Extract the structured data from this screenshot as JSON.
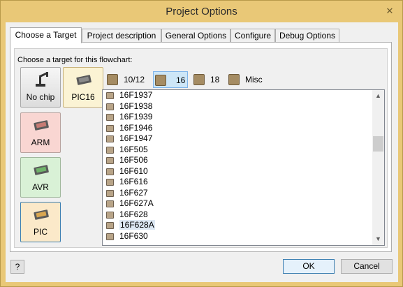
{
  "window": {
    "title": "Project Options",
    "close_glyph": "✕"
  },
  "tabs": [
    {
      "label": "Choose a Target",
      "active": true
    },
    {
      "label": "Project description",
      "active": false
    },
    {
      "label": "General Options",
      "active": false
    },
    {
      "label": "Configure",
      "active": false
    },
    {
      "label": "Debug Options",
      "active": false
    }
  ],
  "target_panel": {
    "group_label": "Choose a target for this flowchart:",
    "chip_buttons": [
      {
        "label": "No chip",
        "icon": "robot-arm-icon"
      },
      {
        "label": "PIC16",
        "icon": "chip-icon"
      },
      {
        "label": "ARM",
        "icon": "chip-icon"
      },
      {
        "label": "AVR",
        "icon": "chip-icon"
      },
      {
        "label": "PIC",
        "icon": "chip-icon"
      }
    ],
    "families": [
      {
        "label": "10/12",
        "selected": false
      },
      {
        "label": "16",
        "selected": true
      },
      {
        "label": "18",
        "selected": false
      },
      {
        "label": "Misc",
        "selected": false
      }
    ],
    "devices": [
      "16F1937",
      "16F1938",
      "16F1939",
      "16F1946",
      "16F1947",
      "16F505",
      "16F506",
      "16F610",
      "16F616",
      "16F627",
      "16F627A",
      "16F628",
      "16F628A",
      "16F630"
    ],
    "selected_device": "16F628A",
    "scroll_up_glyph": "▲",
    "scroll_down_glyph": "▼"
  },
  "buttons": {
    "help": "?",
    "ok": "OK",
    "cancel": "Cancel"
  }
}
